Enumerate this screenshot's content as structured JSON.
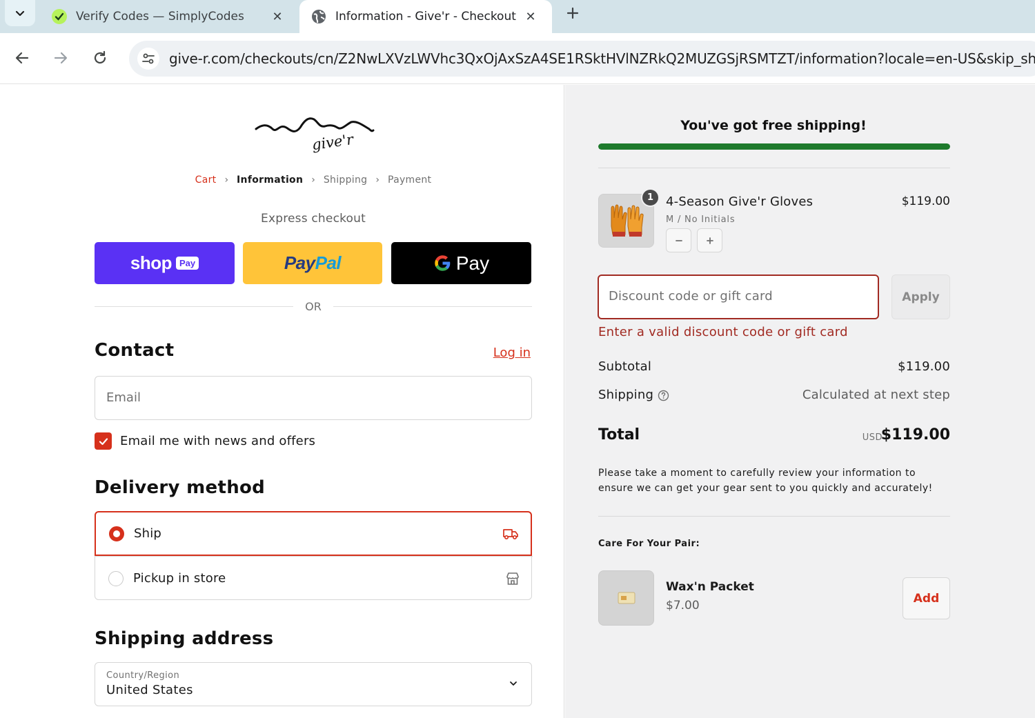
{
  "browser": {
    "tabs": [
      {
        "title": "Verify Codes — SimplyCodes",
        "icon": "simplycodes-icon",
        "active": false
      },
      {
        "title": "Information - Give'r - Checkout",
        "icon": "globe-icon",
        "active": true
      }
    ],
    "url": "give-r.com/checkouts/cn/Z2NwLXVzLWVhc3QxOjAxSzA4SE1RSktHVlNZRkQ2MUZGSjRSMTZT/information?locale=en-US&skip_sho"
  },
  "checkout": {
    "logo_alt": "give'r",
    "breadcrumb": [
      {
        "label": "Cart",
        "state": "link"
      },
      {
        "label": "Information",
        "state": "current"
      },
      {
        "label": "Shipping",
        "state": "upcoming"
      },
      {
        "label": "Payment",
        "state": "upcoming"
      }
    ],
    "express_label": "Express checkout",
    "express_buttons": {
      "shop": "shop",
      "shop_pay_badge": "Pay",
      "paypal_a": "Pay",
      "paypal_b": "Pal",
      "gpay": "Pay"
    },
    "or_label": "OR",
    "contact": {
      "heading": "Contact",
      "login_label": "Log in",
      "email_placeholder": "Email",
      "newsletter_label": "Email me with news and offers",
      "newsletter_checked": true
    },
    "delivery": {
      "heading": "Delivery method",
      "options": [
        {
          "label": "Ship",
          "selected": true,
          "icon": "truck-icon"
        },
        {
          "label": "Pickup in store",
          "selected": false,
          "icon": "store-icon"
        }
      ]
    },
    "shipping_address": {
      "heading": "Shipping address",
      "country_label": "Country/Region",
      "country_value": "United States"
    }
  },
  "summary": {
    "free_shipping_text": "You've got free shipping!",
    "free_shipping_progress": 1.0,
    "accent_color": "#1e7a2c",
    "line_items": [
      {
        "name": "4-Season Give'r Gloves",
        "variant": "M / No Initials",
        "price": "$119.00",
        "quantity": "1"
      }
    ],
    "discount": {
      "placeholder": "Discount code or gift card",
      "apply_label": "Apply",
      "error": "Enter a valid discount code or gift card"
    },
    "subtotal_label": "Subtotal",
    "subtotal_value": "$119.00",
    "shipping_label": "Shipping",
    "shipping_value": "Calculated at next step",
    "total_label": "Total",
    "total_currency": "USD",
    "total_value": "$119.00",
    "review_note": "Please take a moment to carefully review your information to ensure we can get your gear sent to you quickly and accurately!",
    "upsell_heading": "Care For Your Pair:",
    "upsell": {
      "name": "Wax'n Packet",
      "price": "$7.00",
      "add_label": "Add"
    }
  }
}
